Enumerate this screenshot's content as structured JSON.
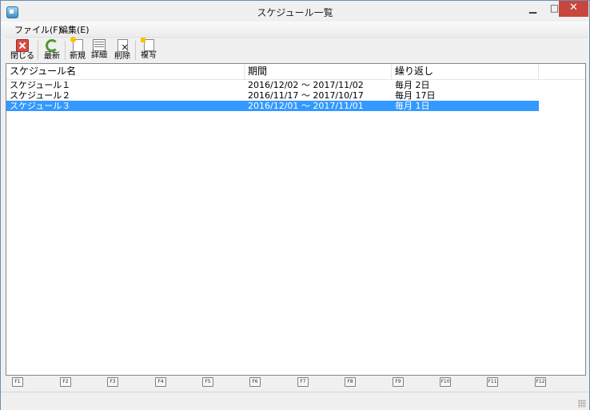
{
  "window": {
    "title": "スケジュール一覧"
  },
  "menu": {
    "items": [
      "ファイル(F)",
      "編集(E)"
    ]
  },
  "toolbar": {
    "buttons": [
      {
        "label": "閉じる",
        "icon": "close-icon"
      },
      {
        "label": "最新",
        "icon": "refresh-icon"
      },
      {
        "label": "新規",
        "icon": "new-document-icon"
      },
      {
        "label": "詳細",
        "icon": "detail-icon"
      },
      {
        "label": "削除",
        "icon": "delete-icon"
      },
      {
        "label": "複写",
        "icon": "copy-icon"
      }
    ]
  },
  "list": {
    "columns": [
      "スケジュール名",
      "期間",
      "繰り返し"
    ],
    "rows": [
      {
        "name": "スケジュール１",
        "period": "2016/12/02 ～ 2017/11/02",
        "repeat": "毎月 2日"
      },
      {
        "name": "スケジュール２",
        "period": "2016/11/17 ～ 2017/10/17",
        "repeat": "毎月 17日"
      },
      {
        "name": "スケジュール３",
        "period": "2016/12/01 ～ 2017/11/01",
        "repeat": "毎月 1日",
        "selected": true
      }
    ]
  },
  "function_keys": [
    "F1",
    "F2",
    "F3",
    "F4",
    "F5",
    "F6",
    "F7",
    "F8",
    "F9",
    "F10",
    "F11",
    "F12"
  ],
  "colors": {
    "selection": "#3399ff",
    "close_button": "#c7463e"
  }
}
